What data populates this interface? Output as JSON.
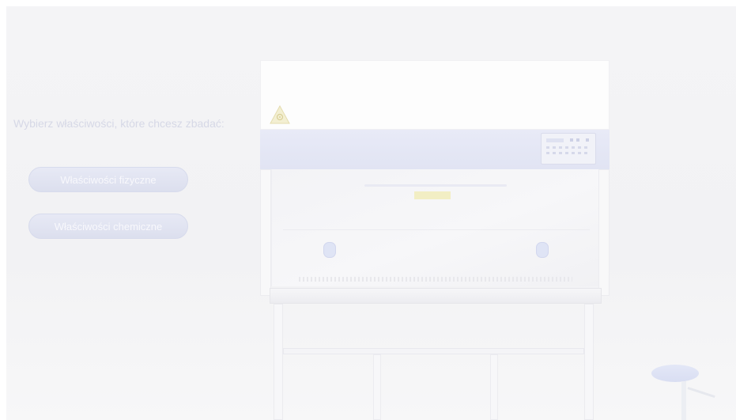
{
  "prompt": {
    "text": "Wybierz właściwości, które chcesz zbadać:"
  },
  "buttons": [
    {
      "label": "Właściwości fizyczne"
    },
    {
      "label": "Właściwości chemiczne"
    }
  ],
  "colors": {
    "prompt_text": "#d6d8e6",
    "button_fill": "#e0e3f1",
    "cabinet_band": "#e4e7f5"
  },
  "icons": {
    "warning": "biohazard-warning-icon"
  }
}
